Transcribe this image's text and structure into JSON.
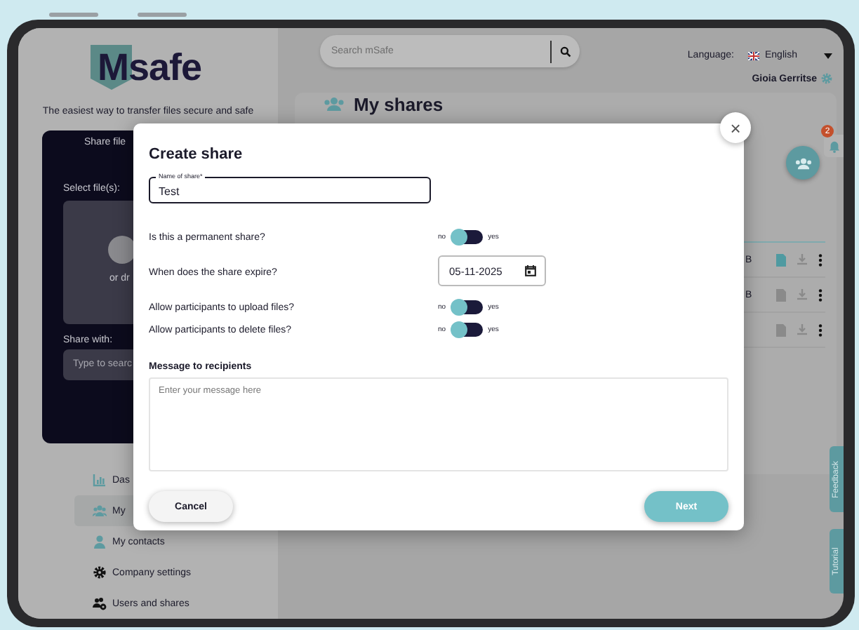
{
  "sidebar": {
    "logo": "Msafe",
    "tagline": "The easiest way to transfer files secure and safe",
    "share_panel": {
      "title": "Share file",
      "select_label": "Select file(s):",
      "drop_text": "or dr",
      "share_with_label": "Share with:",
      "search_placeholder": "Type to searc"
    },
    "nav_items": [
      {
        "label": "Das",
        "selected": false
      },
      {
        "label": "My",
        "selected": true
      },
      {
        "label": "My contacts",
        "selected": false
      },
      {
        "label": "Company settings",
        "selected": false
      },
      {
        "label": "Users and shares",
        "selected": false
      }
    ]
  },
  "header": {
    "search": {
      "placeholder": "Search mSafe"
    },
    "language_label": "Language:",
    "language": "English",
    "user": "Gioia Gerritse"
  },
  "page": {
    "title": "My shares",
    "notification_count": "2",
    "rows": [
      {
        "size": "B",
        "file_highlighted": true
      },
      {
        "size": "B",
        "file_highlighted": false
      },
      {
        "file_highlighted": false
      }
    ]
  },
  "side_tabs": [
    "Feedback",
    "Tutorial"
  ],
  "modal": {
    "close": "×",
    "title": "Create share",
    "name_field": {
      "label": "Name of share*",
      "value": "Test"
    },
    "settings": [
      {
        "kind": "toggle",
        "label": "Is this a permanent share?",
        "off_label": "no",
        "on_label": "yes",
        "on": false
      },
      {
        "kind": "date",
        "label": "When does the share expire?",
        "value": "05-11-2025"
      },
      {
        "kind": "toggle",
        "label": "Allow participants to upload files?",
        "off_label": "no",
        "on_label": "yes",
        "on": false
      },
      {
        "kind": "toggle",
        "label": "Allow participants to delete files?",
        "off_label": "no",
        "on_label": "yes",
        "on": false
      }
    ],
    "message": {
      "label": "Message to recipients",
      "placeholder": "Enter your message here"
    },
    "buttons": [
      {
        "kind": "secondary",
        "label": "Cancel"
      },
      {
        "kind": "primary",
        "label": "Next"
      }
    ]
  }
}
